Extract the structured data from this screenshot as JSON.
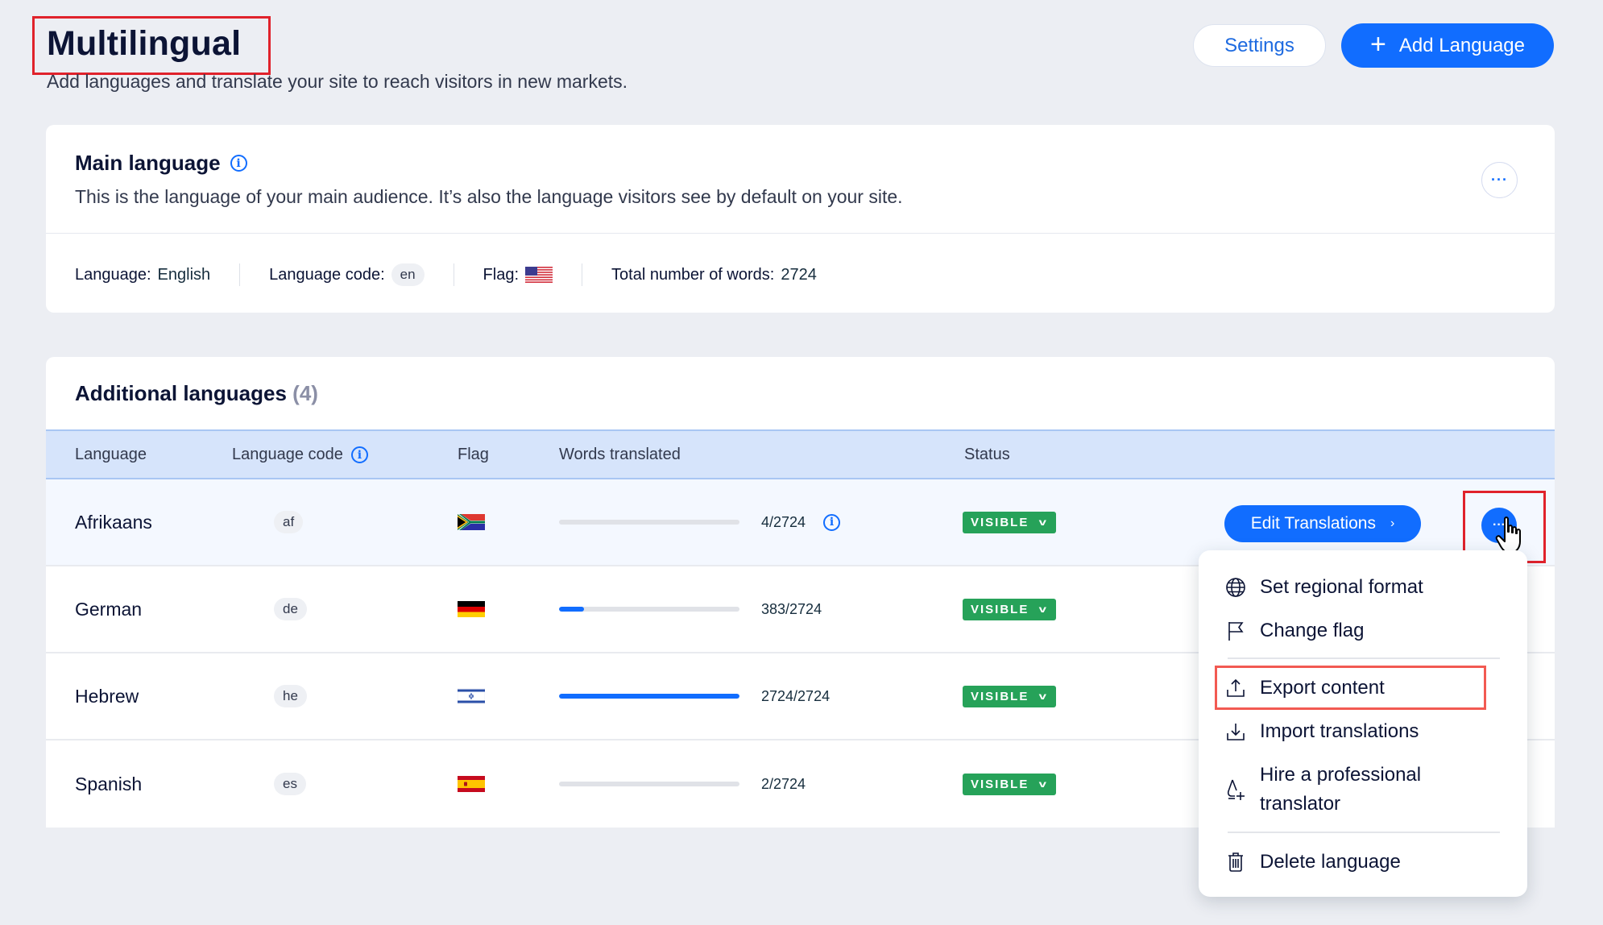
{
  "header": {
    "title": "Multilingual",
    "subtitle": "Add languages and translate your site to reach visitors in new markets.",
    "settings_label": "Settings",
    "add_language_label": "Add Language",
    "add_icon": "plus-icon"
  },
  "main_language": {
    "title": "Main language",
    "description": "This is the language of your main audience. It’s also the language visitors see by default on your site.",
    "language_label": "Language:",
    "language_value": "English",
    "code_label": "Language code:",
    "code_value": "en",
    "flag_label": "Flag:",
    "flag": "us-flag",
    "words_label": "Total number of words:",
    "words_value": "2724",
    "more_icon": "more-horizontal-icon"
  },
  "additional": {
    "title": "Additional languages",
    "count": "(4)",
    "columns": {
      "language": "Language",
      "code": "Language code",
      "flag": "Flag",
      "words": "Words translated",
      "status": "Status"
    },
    "rows": [
      {
        "language": "Afrikaans",
        "code": "af",
        "flag": "za-flag",
        "translated": 4,
        "total": 2724,
        "words": "4/2724",
        "status": "VISIBLE",
        "has_info": true
      },
      {
        "language": "German",
        "code": "de",
        "flag": "de-flag",
        "translated": 383,
        "total": 2724,
        "words": "383/2724",
        "status": "VISIBLE",
        "has_info": false
      },
      {
        "language": "Hebrew",
        "code": "he",
        "flag": "il-flag",
        "translated": 2724,
        "total": 2724,
        "words": "2724/2724",
        "status": "VISIBLE",
        "has_info": false
      },
      {
        "language": "Spanish",
        "code": "es",
        "flag": "es-flag",
        "translated": 2,
        "total": 2724,
        "words": "2/2724",
        "status": "VISIBLE",
        "has_info": false
      }
    ],
    "edit_translations_label": "Edit Translations"
  },
  "menu": {
    "items": [
      {
        "label": "Set regional format",
        "icon": "globe-icon"
      },
      {
        "label": "Change flag",
        "icon": "flag-icon"
      },
      {
        "label": "Export content",
        "icon": "upload-icon"
      },
      {
        "label": "Import translations",
        "icon": "download-icon"
      },
      {
        "label": "Hire a professional translator",
        "label_line1": "Hire a professional",
        "label_line2": "translator",
        "icon": "add-translator-icon"
      },
      {
        "label": "Delete language",
        "icon": "trash-icon"
      }
    ]
  },
  "colors": {
    "accent": "#116dff",
    "status_visible": "#26a259",
    "highlight": "#e0222b",
    "background": "#eceef3"
  }
}
